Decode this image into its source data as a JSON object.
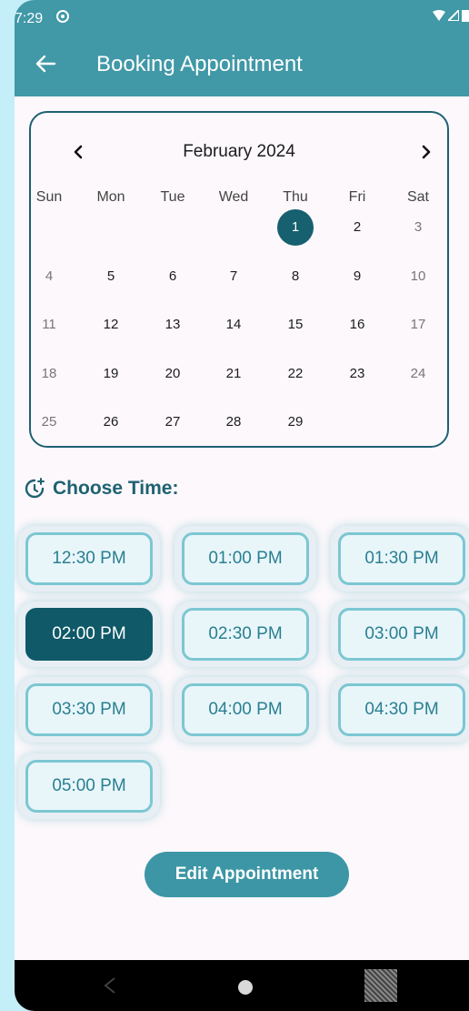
{
  "status_bar": {
    "time": "7:29",
    "icons": [
      "sync-icon",
      "wifi-icon",
      "signal-icon",
      "battery-icon"
    ]
  },
  "app_bar": {
    "title": "Booking Appointment",
    "back_icon": "arrow-left-icon"
  },
  "calendar": {
    "month_label": "February 2024",
    "prev_icon": "chevron-left-icon",
    "next_icon": "chevron-right-icon",
    "weekdays": [
      "Sun",
      "Mon",
      "Tue",
      "Wed",
      "Thu",
      "Fri",
      "Sat"
    ],
    "days": [
      "1",
      "2",
      "3",
      "4",
      "5",
      "6",
      "7",
      "8",
      "9",
      "10",
      "11",
      "12",
      "13",
      "14",
      "15",
      "16",
      "17",
      "18",
      "19",
      "20",
      "21",
      "22",
      "23",
      "24",
      "25",
      "26",
      "27",
      "28",
      "29"
    ],
    "first_weekday_index": 4,
    "selected_day": "1"
  },
  "time_section": {
    "label": "Choose Time:",
    "icon": "clock-plus-icon",
    "slots": [
      "12:30 PM",
      "01:00 PM",
      "01:30 PM",
      "02:00 PM",
      "02:30 PM",
      "03:00 PM",
      "03:30 PM",
      "04:00 PM",
      "04:30 PM",
      "05:00 PM"
    ],
    "selected_slot": "02:00 PM"
  },
  "actions": {
    "edit_label": "Edit Appointment"
  },
  "colors": {
    "app_bar": "#4198a7",
    "accent_dark": "#16606f",
    "slot_border": "#7cc7d2",
    "slot_text": "#2a7f90",
    "background": "#fcf8fb"
  }
}
